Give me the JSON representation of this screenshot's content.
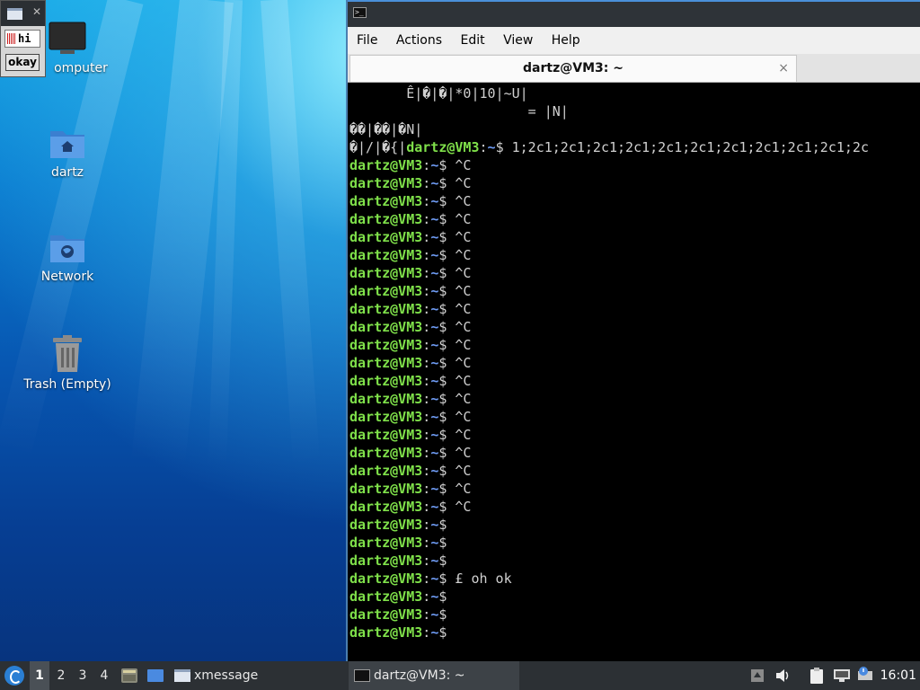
{
  "desktop": {
    "icons": [
      {
        "label": "omputer"
      },
      {
        "label": "dartz"
      },
      {
        "label": "Network"
      },
      {
        "label": "Trash (Empty)"
      }
    ]
  },
  "xmessage": {
    "text": "hi",
    "button": "okay"
  },
  "terminal": {
    "menu": [
      "File",
      "Actions",
      "Edit",
      "View",
      "Help"
    ],
    "tab_title": "dartz@VM3: ~",
    "tab_close": "×",
    "user": "dartz@VM3",
    "path": "~",
    "prompt_sep": ":",
    "prompt_dollar": "$",
    "garbage_lines": [
      "       Ê|�|�|*0|10|~U|",
      "                      = |N|",
      "��|��|�N|"
    ],
    "first_prompt_prefix": "�|/|�{|",
    "first_prompt_cmd": " 1;2c1;2c1;2c1;2c1;2c1;2c1;2c1;2c1;2c1;2c1;2c",
    "commands": [
      " ^C",
      " ^C",
      " ^C",
      " ^C",
      " ^C",
      " ^C",
      " ^C",
      " ^C",
      " ^C",
      " ^C",
      " ^C",
      " ^C",
      " ^C",
      " ^C",
      " ^C",
      " ^C",
      " ^C",
      " ^C",
      " ^C",
      " ^C",
      "",
      "",
      "",
      " £ oh ok",
      "",
      "",
      ""
    ]
  },
  "taskbar": {
    "workspaces": [
      "1",
      "2",
      "3",
      "4"
    ],
    "active_workspace": "1",
    "tasks": [
      {
        "label": "xmessage"
      },
      {
        "label": "dartz@VM3: ~"
      }
    ],
    "clock": "16:01"
  },
  "colors": {
    "prompt_user": "#7fe04a",
    "prompt_path": "#6f9cf5",
    "taskbar": "#2c3034"
  }
}
